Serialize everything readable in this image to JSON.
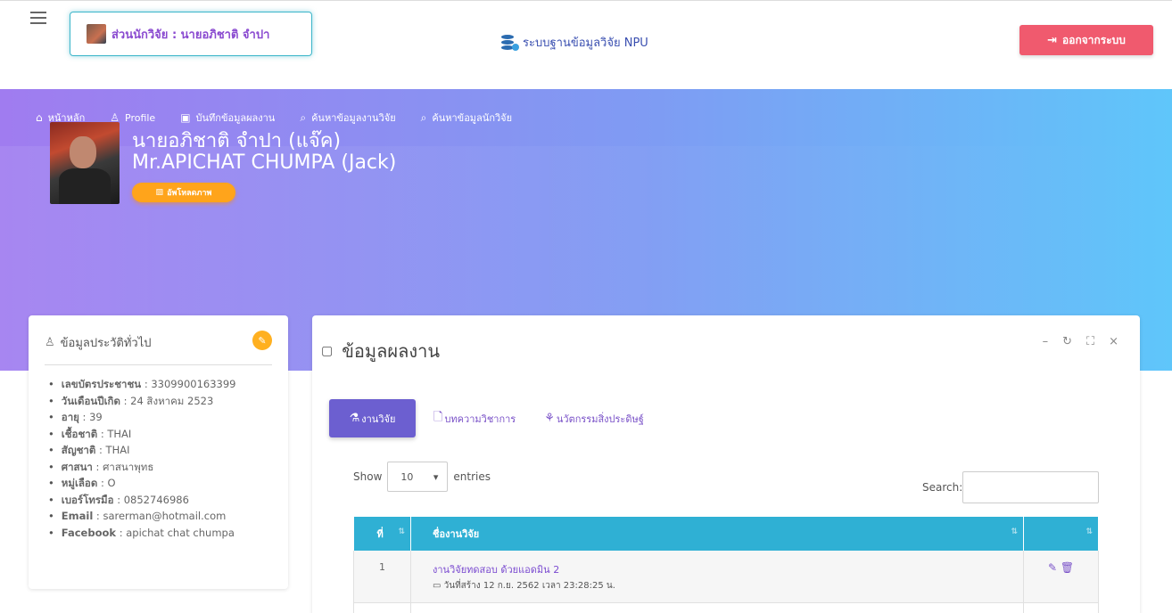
{
  "header": {
    "user_label": "ส่วนนักวิจัย : นายอภิชาติ จำปา",
    "brand": "ระบบฐานข้อมูลวิจัย NPU",
    "logout_label": "ออกจากระบบ"
  },
  "nav": {
    "items": [
      {
        "label": "หน้าหลัก",
        "icon": "home-icon"
      },
      {
        "label": "Profile",
        "icon": "user-icon"
      },
      {
        "label": "บันทึกข้อมูลผลงาน",
        "icon": "save-icon"
      },
      {
        "label": "ค้นหาข้อมูลงานวิจัย",
        "icon": "search-icon"
      },
      {
        "label": "ค้นหาข้อมูลนักวิจัย",
        "icon": "search-icon"
      }
    ]
  },
  "profile": {
    "name_th": "นายอภิชาติ จำปา (แจ๊ค)",
    "name_en": "Mr.APICHAT CHUMPA (Jack)",
    "upload_label": "อัพโหลดภาพ"
  },
  "info": {
    "title": "ข้อมูลประวัติทั่วไป",
    "rows": [
      {
        "k": "เลขบัตรประชาชน",
        "v": "3309900163399"
      },
      {
        "k": "วันเดือนปีเกิด",
        "v": "24 สิงหาคม 2523"
      },
      {
        "k": "อายุ",
        "v": "39"
      },
      {
        "k": "เชื้อชาติ",
        "v": "THAI"
      },
      {
        "k": "สัญชาติ",
        "v": "THAI"
      },
      {
        "k": "ศาสนา",
        "v": "ศาสนาพุทธ"
      },
      {
        "k": "หมู่เลือด",
        "v": "O"
      },
      {
        "k": "เบอร์โทรมือ",
        "v": "0852746986"
      },
      {
        "k": "Email",
        "v": "sarerman@hotmail.com"
      },
      {
        "k": "Facebook",
        "v": "apichat chat chumpa"
      }
    ]
  },
  "panel": {
    "title": "ข้อมูลผลงาน",
    "tabs": [
      "งานวิจัย",
      "บทความวิชาการ",
      "นวัตกรรมสิ่งประดิษฐ์"
    ],
    "show_label": "Show",
    "entries_value": "10",
    "entries_label": "entries",
    "search_label": "Search:",
    "columns": [
      "ที่",
      "ชื่องานวิจัย",
      ""
    ],
    "rows": [
      {
        "no": "1",
        "title": "งานวิจัยทดสอบ ด้วยแอดมิน 2",
        "date": "วันที่สร้าง 12 ก.ย. 2562 เวลา 23:28:25 น."
      }
    ]
  },
  "colors": {
    "accent": "#6c5fd0",
    "logout": "#f05a6e",
    "table_header": "#2fb0d4",
    "upload": "#ffa41b"
  }
}
